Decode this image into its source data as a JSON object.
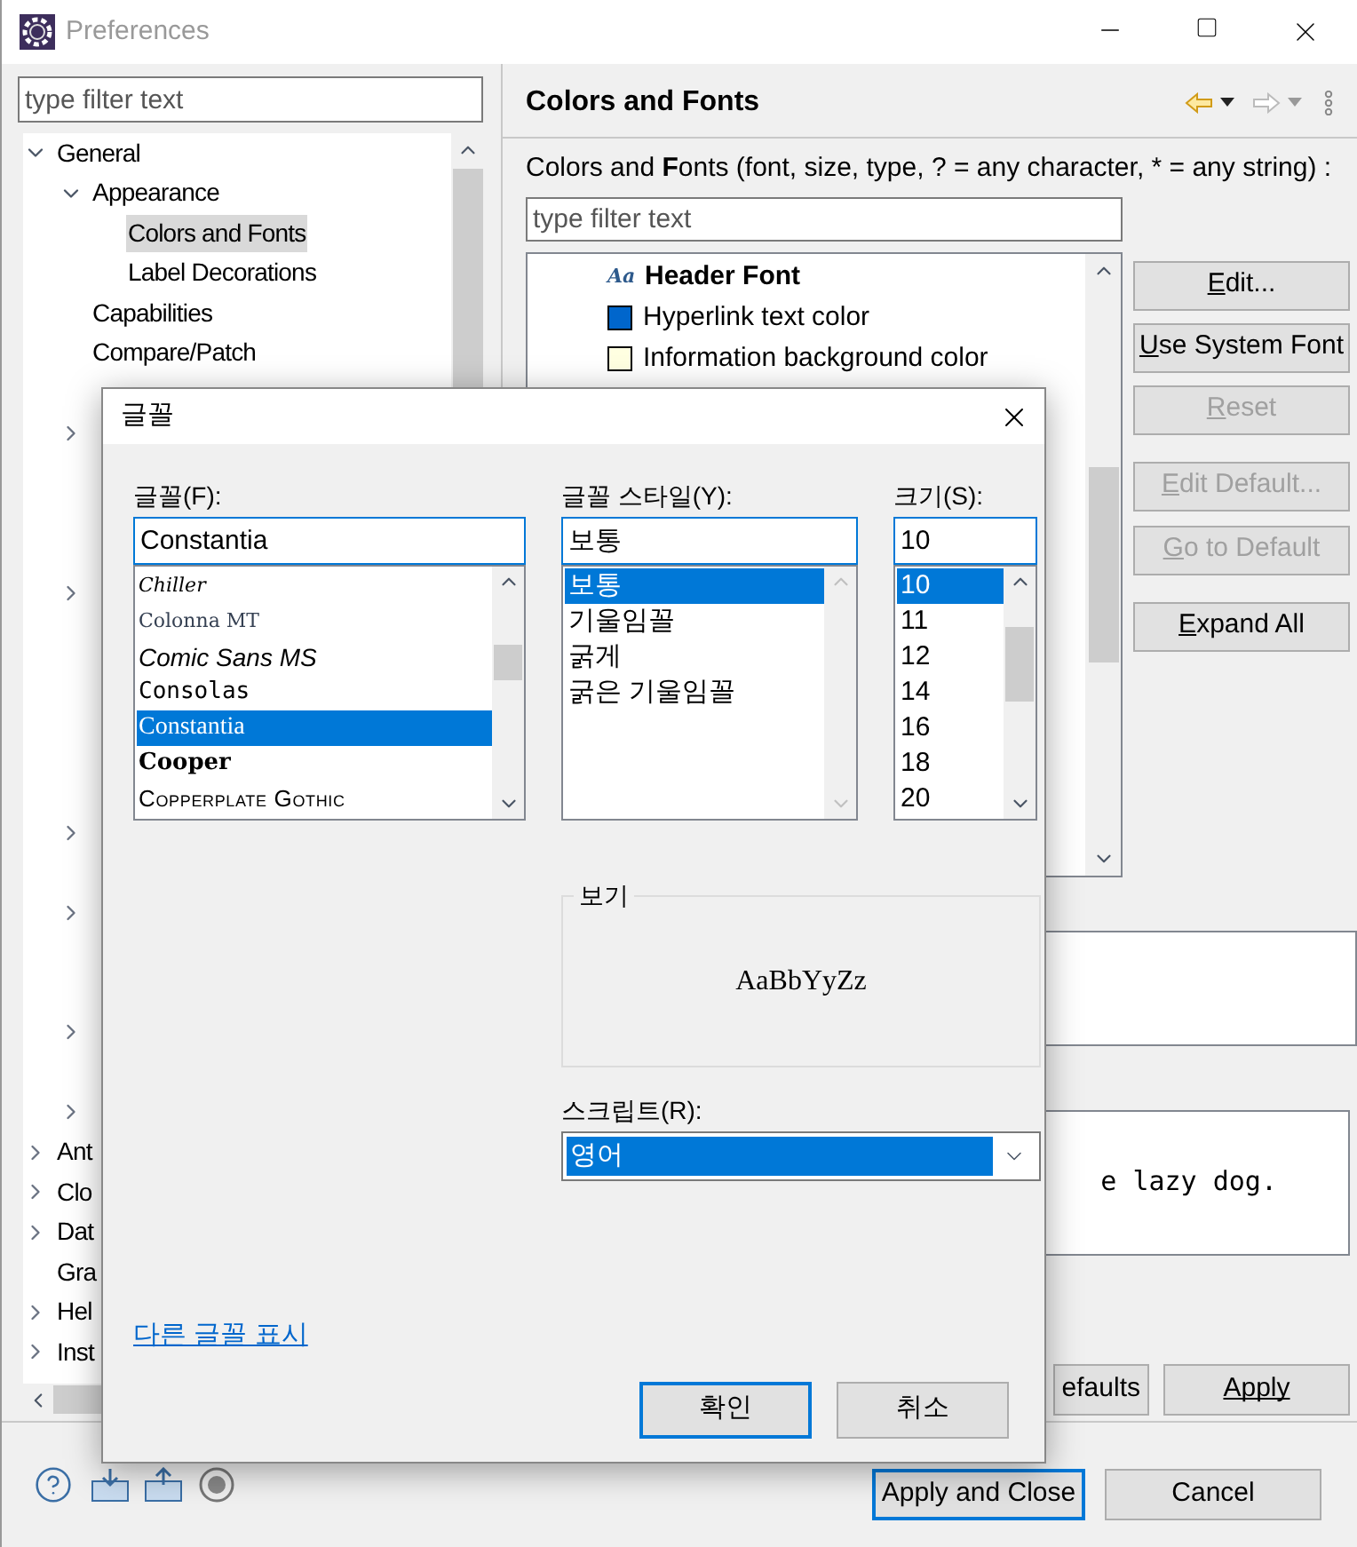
{
  "window": {
    "title": "Preferences"
  },
  "sidebar": {
    "filter_placeholder": "type filter text",
    "tree": [
      {
        "label": "General",
        "expandable": true,
        "expanded": true,
        "selected": false,
        "children": [
          {
            "label": "Appearance",
            "expandable": true,
            "expanded": true,
            "selected": false,
            "children": [
              {
                "label": "Colors and Fonts",
                "expandable": false,
                "selected": true
              },
              {
                "label": "Label Decorations",
                "expandable": false,
                "selected": false
              }
            ]
          },
          {
            "label": "Capabilities",
            "expandable": false,
            "selected": false
          },
          {
            "label": "Compare/Patch",
            "expandable": false,
            "selected": false
          },
          {
            "expandable": false
          },
          {
            "expandable": true
          },
          {
            "expandable": false
          },
          {
            "expandable": false
          },
          {
            "expandable": false
          },
          {
            "expandable": true
          },
          {
            "expandable": false
          },
          {
            "expandable": false
          },
          {
            "expandable": false
          },
          {
            "expandable": false
          },
          {
            "expandable": false
          },
          {
            "expandable": true
          },
          {
            "expandable": false
          },
          {
            "expandable": true
          },
          {
            "expandable": false
          },
          {
            "expandable": false
          },
          {
            "expandable": true
          },
          {
            "expandable": false
          },
          {
            "expandable": true
          }
        ]
      },
      {
        "label": "Ant",
        "expandable": true,
        "expanded": false,
        "selected": false
      },
      {
        "label": "Clo",
        "expandable": true,
        "expanded": false,
        "selected": false
      },
      {
        "label": "Dat",
        "expandable": true,
        "expanded": false,
        "selected": false
      },
      {
        "label": "Gra",
        "expandable": false,
        "selected": false
      },
      {
        "label": "Hel",
        "expandable": true,
        "expanded": false,
        "selected": false
      },
      {
        "label": "Inst",
        "expandable": true,
        "expanded": false,
        "selected": false
      }
    ]
  },
  "page": {
    "title": "Colors and Fonts",
    "filter_label": "Colors and **F**onts (font, size, type, ? = any character, * = any string) :",
    "filter_placeholder": "type filter text",
    "items": [
      {
        "kind": "font",
        "label": "Header Font",
        "icon_text": "Aa"
      },
      {
        "kind": "color",
        "label": "Hyperlink text color",
        "color": "#0066cc"
      },
      {
        "kind": "color",
        "label": "Information background color",
        "color": "#ffffe1"
      }
    ],
    "buttons": [
      {
        "label": "Edit...",
        "disabled": false
      },
      {
        "label": "Use System Font",
        "disabled": false
      },
      {
        "label": "Reset",
        "disabled": true
      },
      {
        "label": "Edit Default...",
        "disabled": true
      },
      {
        "label": "Go to Default",
        "disabled": true
      },
      {
        "label": "Expand All",
        "disabled": false
      }
    ],
    "preview_text": "e lazy dog.",
    "restore_button": "efaults",
    "apply_button": "Apply"
  },
  "footer": {
    "apply_close_button": "Apply and Close",
    "cancel_button": "Cancel"
  },
  "font_dialog": {
    "title": "글꼴",
    "font_label": "글꼴(F):",
    "font_value": "Constantia",
    "fonts": [
      {
        "label": "Chiller",
        "kind": "decorative",
        "selected": false
      },
      {
        "label": "Colonna MT",
        "kind": "outline",
        "selected": false
      },
      {
        "label": "Comic Sans MS",
        "kind": "casual",
        "selected": false
      },
      {
        "label": "Consolas",
        "kind": "mono",
        "selected": false
      },
      {
        "label": "Constantia",
        "kind": "serif",
        "selected": true
      },
      {
        "label": "Cooper",
        "kind": "heavy",
        "selected": false
      },
      {
        "label": "Copperplate Gothic",
        "kind": "smallcaps",
        "selected": false
      }
    ],
    "style_label": "글꼴 스타일(Y):",
    "style_value": "보통",
    "styles": [
      {
        "label": "보통",
        "selected": true
      },
      {
        "label": "기울임꼴",
        "selected": false
      },
      {
        "label": "굵게",
        "selected": false
      },
      {
        "label": "굵은 기울임꼴",
        "selected": false
      }
    ],
    "size_label": "크기(S):",
    "size_value": "10",
    "sizes": [
      {
        "label": "10",
        "selected": true
      },
      {
        "label": "11",
        "selected": false
      },
      {
        "label": "12",
        "selected": false
      },
      {
        "label": "14",
        "selected": false
      },
      {
        "label": "16",
        "selected": false
      },
      {
        "label": "18",
        "selected": false
      },
      {
        "label": "20",
        "selected": false
      }
    ],
    "sample_label": "보기",
    "sample_text": "AaBbYyZz",
    "script_label": "스크립트(R):",
    "script_value": "영어",
    "more_fonts_link": "다른 글꼴 표시",
    "ok_button": "확인",
    "cancel_button": "취소"
  }
}
